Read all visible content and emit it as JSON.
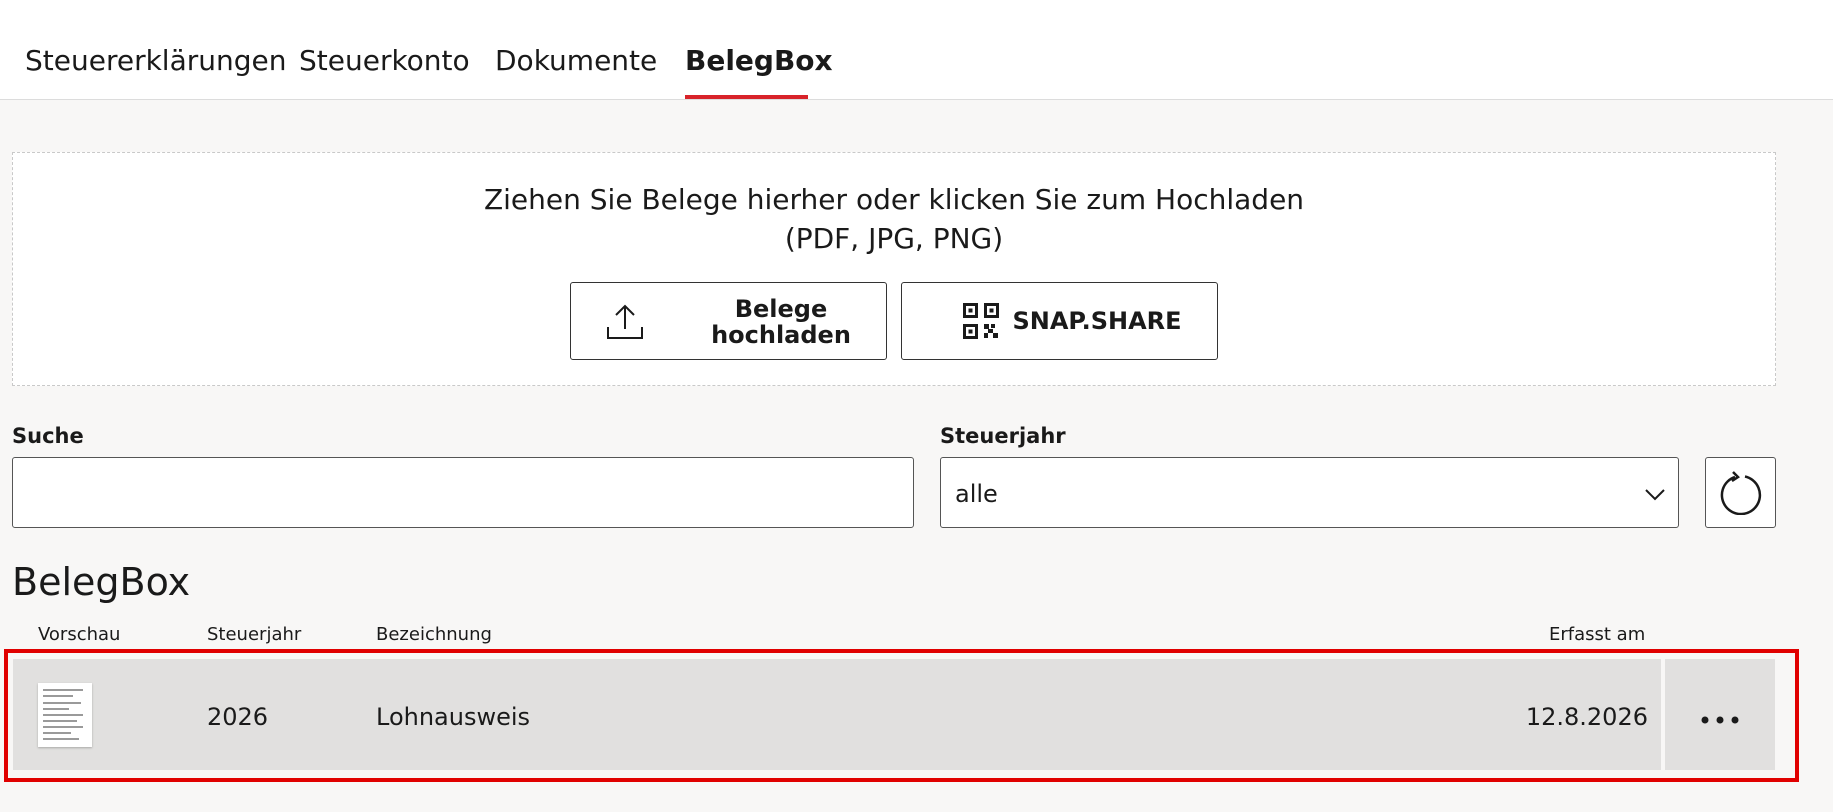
{
  "tabs": [
    {
      "label": "Steuererklärungen",
      "active": false
    },
    {
      "label": "Steuerkonto",
      "active": false
    },
    {
      "label": "Dokumente",
      "active": false
    },
    {
      "label": "BelegBox",
      "active": true
    }
  ],
  "upload": {
    "hint_line1": "Ziehen Sie Belege hierher oder klicken Sie zum Hochladen",
    "hint_line2": "(PDF, JPG, PNG)",
    "upload_button_line1": "Belege",
    "upload_button_line2": "hochladen",
    "upload_icon": "upload-icon",
    "snapshare_button": "SNAP.SHARE",
    "snapshare_icon": "qr-code-icon"
  },
  "filters": {
    "search_label": "Suche",
    "search_value": "",
    "year_label": "Steuerjahr",
    "year_value": "alle",
    "reset_icon": "refresh-icon"
  },
  "section_title": "BelegBox",
  "table": {
    "headers": [
      "Vorschau",
      "Steuerjahr",
      "Bezeichnung",
      "Erfasst am"
    ],
    "rows": [
      {
        "year": "2026",
        "name": "Lohnausweis",
        "date": "12.8.2026"
      }
    ]
  },
  "colors": {
    "accent": "#d8232a",
    "highlight": "#e00000",
    "row_background": "#e1e0df",
    "page_background": "#f8f7f6"
  }
}
